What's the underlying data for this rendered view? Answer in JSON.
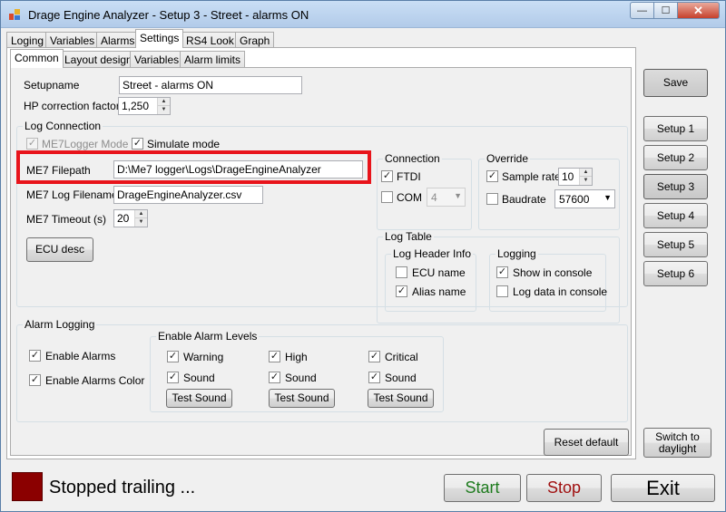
{
  "window": {
    "title": "Drage Engine Analyzer - Setup 3 - Street - alarms ON",
    "min_glyph": "—",
    "max_glyph": "☐",
    "close_glyph": "✕"
  },
  "top_tabs": [
    "Loging",
    "Variables",
    "Alarms",
    "Settings",
    "RS4 Look",
    "Graph"
  ],
  "sub_tabs": [
    "Common",
    "Layout design",
    "Variables",
    "Alarm limits"
  ],
  "common": {
    "setupname_label": "Setupname",
    "setupname_value": "Street - alarms ON",
    "hp_label": "HP correction factor",
    "hp_value": "1,250"
  },
  "log_connection": {
    "title": "Log Connection",
    "me7logger_mode": "ME7Logger Mode",
    "simulate_mode": "Simulate mode",
    "filepath_label": "ME7 Filepath",
    "filepath_value": "D:\\Me7 logger\\Logs\\DrageEngineAnalyzer",
    "log_filename_label": "ME7 Log Filename",
    "log_filename_value": "DrageEngineAnalyzer.csv",
    "timeout_label": "ME7 Timeout (s)",
    "timeout_value": "20",
    "ecu_desc": "ECU desc"
  },
  "connection": {
    "title": "Connection",
    "ftdi": "FTDI",
    "com": "COM",
    "com_value": "4"
  },
  "override": {
    "title": "Override",
    "sample_rate": "Sample rate",
    "sample_rate_value": "10",
    "baudrate": "Baudrate",
    "baudrate_value": "57600"
  },
  "log_table": {
    "title": "Log Table",
    "header_info_title": "Log Header Info",
    "ecu_name": "ECU name",
    "alias_name": "Alias name",
    "logging_title": "Logging",
    "show_in_console": "Show in console",
    "log_data_in_console": "Log data in console"
  },
  "alarm_logging": {
    "title": "Alarm Logging",
    "enable_alarms": "Enable Alarms",
    "enable_alarms_color": "Enable Alarms Color",
    "levels_title": "Enable Alarm Levels",
    "warning": "Warning",
    "high": "High",
    "critical": "Critical",
    "sound": "Sound",
    "test_sound": "Test Sound"
  },
  "reset_default": "Reset default",
  "sidebar": {
    "save": "Save",
    "setups": [
      "Setup 1",
      "Setup 2",
      "Setup 3",
      "Setup 4",
      "Setup 5",
      "Setup 6"
    ],
    "active_setup": "Setup 3",
    "switch_daylight": "Switch to daylight"
  },
  "status": {
    "text": "Stopped trailing ...",
    "led_color": "#8b0000"
  },
  "actions": {
    "start": "Start",
    "stop": "Stop",
    "exit": "Exit",
    "start_color": "#1e7b1e",
    "stop_color": "#a01010"
  },
  "highlight_color": "#e8141b"
}
